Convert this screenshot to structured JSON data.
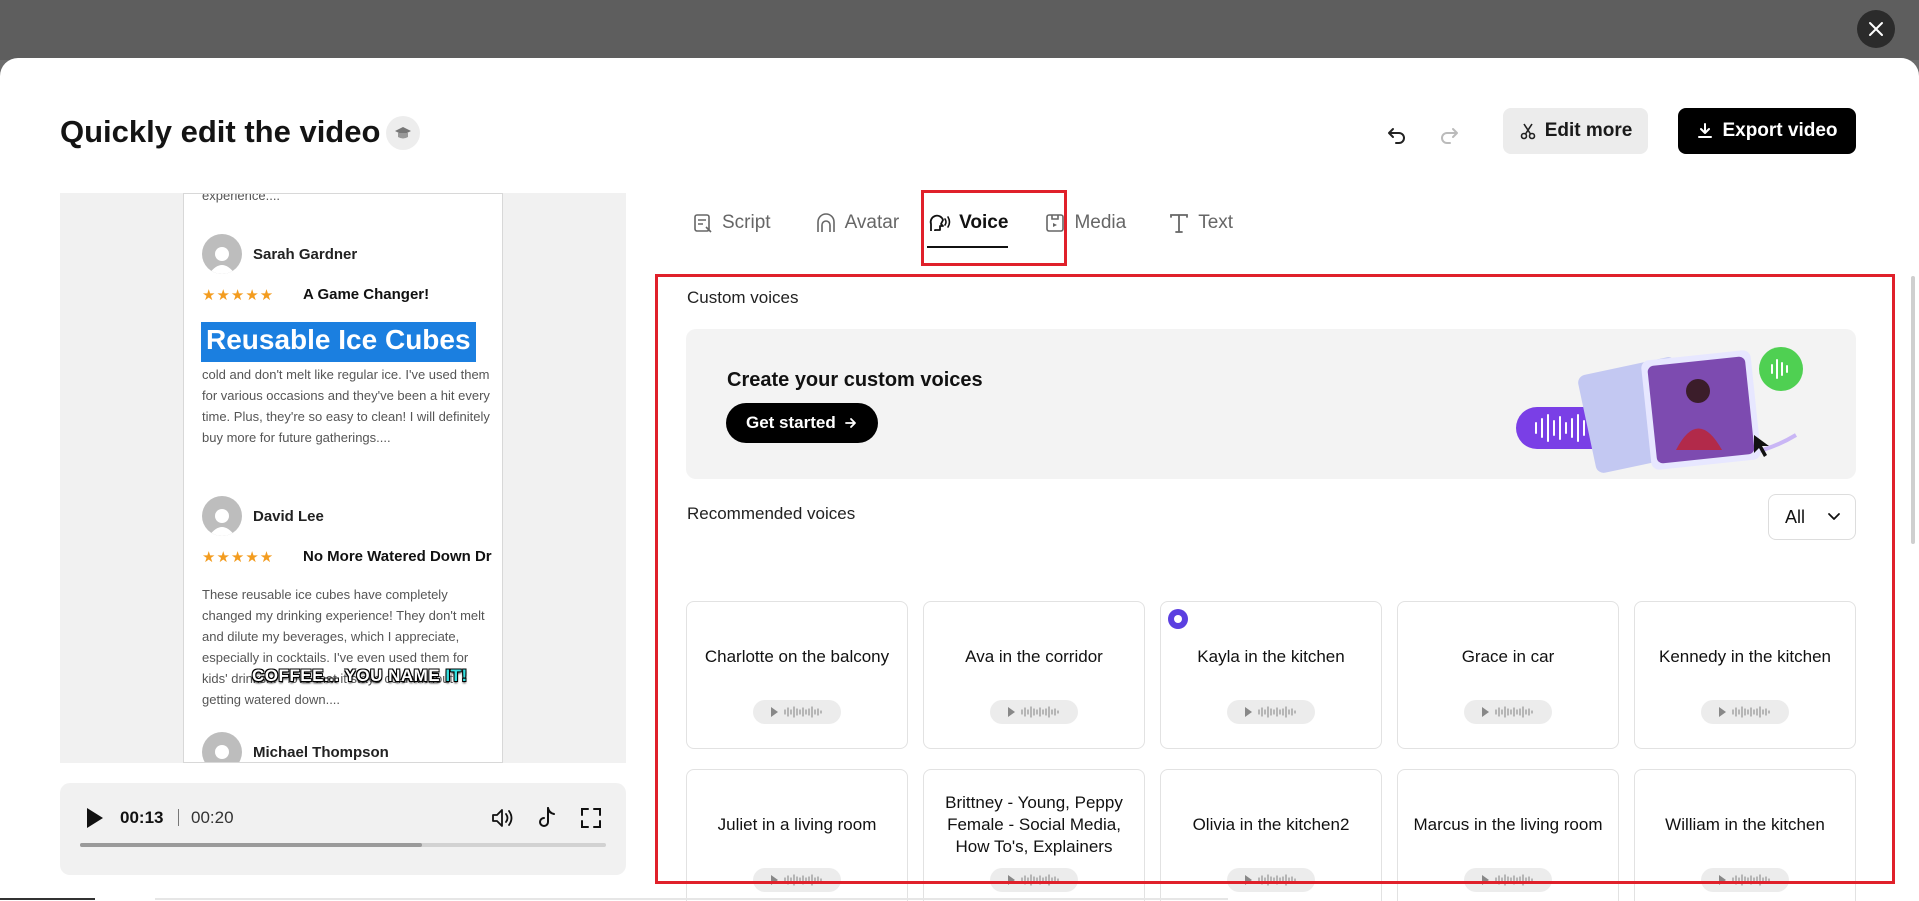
{
  "header": {
    "title": "Quickly edit the video",
    "edit_more_label": "Edit more",
    "export_label": "Export video"
  },
  "preview": {
    "fragment_text": "experience....",
    "reviews": [
      {
        "name": "Sarah Gardner",
        "stars": "★★★★★",
        "title": "A Game Changer!",
        "body": "cold and don't melt like regular ice. I've used them for various occasions and they've been a hit every time. Plus, they're so easy to clean! I will definitely buy more for future gatherings...."
      },
      {
        "name": "David Lee",
        "stars": "★★★★★",
        "title": "No More Watered Down Dr",
        "body": "These reusable ice cubes have completely changed my drinking experience! They don't melt and dilute my beverages, which I appreciate, especially in cocktails. I've even used them for kids' drinks... I love that it stays cold without getting watered down...."
      },
      {
        "name": "Michael Thompson",
        "stars": "",
        "title": "",
        "body": ""
      }
    ],
    "overlay_title": "Reusable Ice Cubes",
    "caption_main": "COFFEE... YOU NAME ",
    "caption_highlight": "IT!"
  },
  "player": {
    "current_time": "00:13",
    "duration": "00:20",
    "progress": 0.65
  },
  "tabs": [
    {
      "label": "Script"
    },
    {
      "label": "Avatar"
    },
    {
      "label": "Voice"
    },
    {
      "label": "Media"
    },
    {
      "label": "Text"
    }
  ],
  "voice_panel": {
    "custom_section_label": "Custom voices",
    "custom_card_title": "Create your custom voices",
    "get_started_label": "Get started",
    "recommended_section_label": "Recommended voices",
    "filter_value": "All",
    "voices": [
      {
        "name": "Charlotte on the balcony"
      },
      {
        "name": "Ava in the corridor"
      },
      {
        "name": "Kayla in the kitchen"
      },
      {
        "name": "Grace in car"
      },
      {
        "name": "Kennedy in the kitchen"
      },
      {
        "name": "Juliet in a living room"
      },
      {
        "name": "Brittney - Young, Peppy Female - Social Media, How To's, Explainers"
      },
      {
        "name": "Olivia in the kitchen2"
      },
      {
        "name": "Marcus in the living room"
      },
      {
        "name": "William in the kitchen"
      }
    ],
    "selected_voice": "Kayla in the kitchen"
  },
  "colors": {
    "highlight_border": "#e0202a",
    "accent_purple": "#5b3fe0",
    "overlay_blue": "#1b7fe0",
    "star_orange": "#f39c1f"
  }
}
